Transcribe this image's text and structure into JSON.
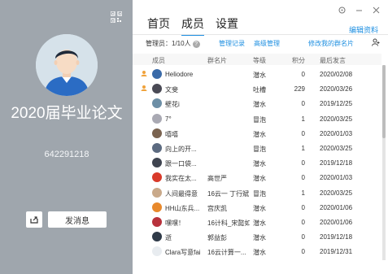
{
  "left": {
    "group_name": "2020届毕业论文",
    "group_id": "642291218",
    "send_label": "发消息",
    "icons": [
      "qr-code-icon",
      "share-icon"
    ]
  },
  "tabs": [
    "首页",
    "成员",
    "设置"
  ],
  "active_tab": "成员",
  "edit_label": "编辑资料",
  "toolbar": {
    "admins": "管理员：1/10人",
    "log": "管理记录",
    "advanced": "高级管理",
    "modify_card": "修改我的群名片"
  },
  "columns": [
    "成员",
    "群名片",
    "等级",
    "积分",
    "最后发言"
  ],
  "members": [
    {
      "name": "Heliodore",
      "card": "",
      "level": "潜水",
      "points": "0",
      "last": "2020/02/08",
      "crown": "owner",
      "avatar": "#3a6aa8"
    },
    {
      "name": "文斐",
      "card": "",
      "level": "吐槽",
      "points": "229",
      "last": "2020/03/26",
      "crown": "admin",
      "avatar": "#4a4a55"
    },
    {
      "name": "壁花i",
      "card": "",
      "level": "潜水",
      "points": "0",
      "last": "2019/12/25",
      "crown": "",
      "avatar": "#6d8fa6"
    },
    {
      "name": "7°",
      "card": "",
      "level": "冒泡",
      "points": "1",
      "last": "2020/03/25",
      "crown": "",
      "avatar": "#a9a9b3"
    },
    {
      "name": "嘻嘻",
      "card": "",
      "level": "潜水",
      "points": "0",
      "last": "2020/01/03",
      "crown": "",
      "avatar": "#7a6350"
    },
    {
      "name": "向上的开...",
      "card": "",
      "level": "冒泡",
      "points": "1",
      "last": "2020/03/25",
      "crown": "",
      "avatar": "#5c6a80"
    },
    {
      "name": "跟一口袋...",
      "card": "",
      "level": "潜水",
      "points": "0",
      "last": "2019/12/18",
      "crown": "",
      "avatar": "#3f4450"
    },
    {
      "name": "我实在太...",
      "card": "高世严",
      "level": "潜水",
      "points": "0",
      "last": "2020/01/03",
      "crown": "",
      "avatar": "#d93a2a"
    },
    {
      "name": "人间最得意",
      "card": "16云一 丁行斌",
      "level": "冒泡",
      "points": "1",
      "last": "2020/03/25",
      "crown": "",
      "avatar": "#c9a98a"
    },
    {
      "name": "HH山东兵...",
      "card": "宫庆凯",
      "level": "潜水",
      "points": "0",
      "last": "2020/01/06",
      "crown": "",
      "avatar": "#e8892c"
    },
    {
      "name": "嘿嘿！",
      "card": "16计科_宋懿如",
      "level": "潜水",
      "points": "0",
      "last": "2020/01/06",
      "crown": "",
      "avatar": "#b8323c"
    },
    {
      "name": "逝",
      "card": "郭益彭",
      "level": "潜水",
      "points": "0",
      "last": "2019/12/18",
      "crown": "",
      "avatar": "#2f3a48"
    },
    {
      "name": "Clara写意fai",
      "card": "16云计算一...",
      "level": "潜水",
      "points": "0",
      "last": "2019/12/31",
      "crown": "",
      "avatar": "#e8ecf0"
    }
  ]
}
